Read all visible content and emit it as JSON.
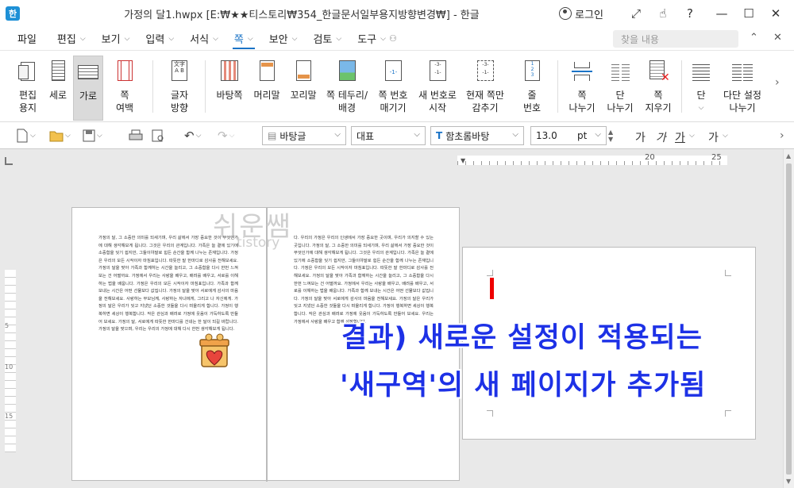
{
  "window": {
    "app_icon": "한",
    "title": "가정의 달1.hwpx [E:₩★★티스토리₩354_한글문서일부용지방향변경₩] - 한글",
    "login": "로그인",
    "controls": [
      "⤢",
      "☝",
      "?",
      "—",
      "☐",
      "✕"
    ]
  },
  "menu": {
    "file": "파일",
    "items": [
      "편집",
      "보기",
      "입력",
      "서식",
      "쪽",
      "보안",
      "검토",
      "도구"
    ],
    "active": "쪽",
    "search_placeholder": "찾을 내용",
    "right_icons": [
      "⌃",
      "✕"
    ]
  },
  "ribbon": {
    "buttons": [
      {
        "name": "edit-paper-button",
        "l1": "편집",
        "l2": "용지",
        "icon": "edit-paper-icon"
      },
      {
        "name": "portrait-button",
        "l1": "세로",
        "l2": "",
        "icon": "portrait-icon"
      },
      {
        "name": "landscape-button",
        "l1": "가로",
        "l2": "",
        "icon": "landscape-icon",
        "selected": true
      },
      {
        "name": "page-margin-button",
        "l1": "쪽",
        "l2": "여백",
        "icon": "page-margin-icon"
      },
      {
        "name": "text-direction-button",
        "l1": "글자",
        "l2": "방향",
        "icon": "text-direction-icon"
      },
      {
        "name": "master-page-button",
        "l1": "바탕쪽",
        "l2": "",
        "icon": "master-page-icon"
      },
      {
        "name": "header-button",
        "l1": "머리말",
        "l2": "",
        "icon": "header-icon"
      },
      {
        "name": "footer-button",
        "l1": "꼬리말",
        "l2": "",
        "icon": "footer-icon"
      },
      {
        "name": "page-border-button",
        "l1": "쪽 테두리/",
        "l2": "배경",
        "icon": "page-border-icon"
      },
      {
        "name": "page-numbering-button",
        "l1": "쪽 번호",
        "l2": "매기기",
        "icon": "page-number-icon"
      },
      {
        "name": "new-number-button",
        "l1": "새 번호로",
        "l2": "시작",
        "icon": "new-number-icon"
      },
      {
        "name": "hide-current-page-button",
        "l1": "현재 쪽만",
        "l2": "감추기",
        "icon": "hide-page-icon"
      },
      {
        "name": "line-number-button",
        "l1": "줄",
        "l2": "번호",
        "icon": "line-number-icon"
      },
      {
        "name": "page-break-button",
        "l1": "쪽",
        "l2": "나누기",
        "icon": "page-break-icon"
      },
      {
        "name": "column-break-button",
        "l1": "단",
        "l2": "나누기",
        "icon": "column-break-icon"
      },
      {
        "name": "delete-page-button",
        "l1": "쪽",
        "l2": "지우기",
        "icon": "delete-page-icon"
      },
      {
        "name": "columns-button",
        "l1": "단",
        "l2": "",
        "icon": "columns-icon"
      },
      {
        "name": "multi-column-button",
        "l1": "다단 설정",
        "l2": "나누기",
        "icon": "multi-column-icon"
      }
    ]
  },
  "toolbar": {
    "style": "바탕글",
    "language": "대표",
    "font": "함초롬바탕",
    "font_icon": "T",
    "size": "13.0",
    "unit": "pt",
    "format_buttons": [
      "가",
      "가",
      "가",
      "가"
    ]
  },
  "ruler": {
    "marks": [
      "20",
      "25"
    ],
    "left_marks": [
      "5",
      "10",
      "15"
    ]
  },
  "document": {
    "watermark": "쉬운쌤",
    "watermark_sub": "tistory",
    "page1_text": "가정의 달, 그 소중한 의미를 되새기며, 우리 삶에서 가장 중요한 것이 무엇인가에 대해 생각해보게 됩니다. 그것은 우리의 관계입니다. 가족은 늘 곁에 있기에 소중함을 잊기 쉽지만, 그들이야말로 힘든 순간을 함께 나누는 존재입니다. 가정은 우리의 모든 시작이자 마침표입니다. 따뜻한 말 한마디로 감사를 전해보세요. 가정의 달을 맞아 가족과 함께하는 시간을 늘리고, 그 소중함을 다시 한번 느껴보는 건 어떨까요. 가정에서 우리는 사랑을 배우고, 배려를 배우고, 서로를 이해하는 법을 배웁니다. 가정은 우리의 모든 시작이자 마침표입니다. 가족과 함께 보내는 시간은 어떤 선물보다 값집니다. 가정의 달을 맞아 서로에게 감사의 마음을 전해보세요. 사랑하는 부모님께, 사랑하는 자녀에게, 그리고 나 자신에게. 가정의 달은 우리가 잊고 지냈던 소중한 것들을 다시 떠올리게 합니다. 가정이 행복하면 세상이 행복합니다. 작은 관심과 배려로 가정에 웃음이 가득하도록 만들어 보세요. 가정의 달, 서로에게 따뜻한 한마디를 건네는 한 달이 되길 바랍니다. 가정의 달을 맞으며, 우리는 우리의 가정에 대해 다시 한번 생각해보게 됩니다.",
    "page2_text": "다. 우리의 가정은 우리의 인생에서 가장 중요한 곳이며, 우리가 의지할 수 있는 곳입니다. 가정의 달, 그 소중한 의미를 되새기며, 우리 삶에서 가장 중요한 것이 무엇인가에 대해 생각해보게 됩니다. 그것은 우리의 관계입니다. 가족은 늘 곁에 있기에 소중함을 잊기 쉽지만, 그들이야말로 힘든 순간을 함께 나누는 존재입니다. 가정은 우리의 모든 시작이자 마침표입니다. 따뜻한 말 한마디로 감사를 전해보세요. 가정의 달을 맞아 가족과 함께하는 시간을 늘리고, 그 소중함을 다시 한번 느껴보는 건 어떨까요. 가정에서 우리는 사랑을 배우고, 배려를 배우고, 서로를 이해하는 법을 배웁니다. 가족과 함께 보내는 시간은 어떤 선물보다 값집니다. 가정의 달을 맞아 서로에게 감사의 마음을 전해보세요. 가정의 달은 우리가 잊고 지냈던 소중한 것들을 다시 떠올리게 합니다. 가정이 행복하면 세상이 행복합니다. 작은 관심과 배려로 가정에 웃음이 가득하도록 만들어 보세요. 우리는 가정에서 사랑을 배우고 함께 성장합니다."
  },
  "overlay": {
    "line1": "결과) 새로운 설정이 적용되는",
    "line2": "'새구역'의 새 페이지가 추가됨"
  }
}
